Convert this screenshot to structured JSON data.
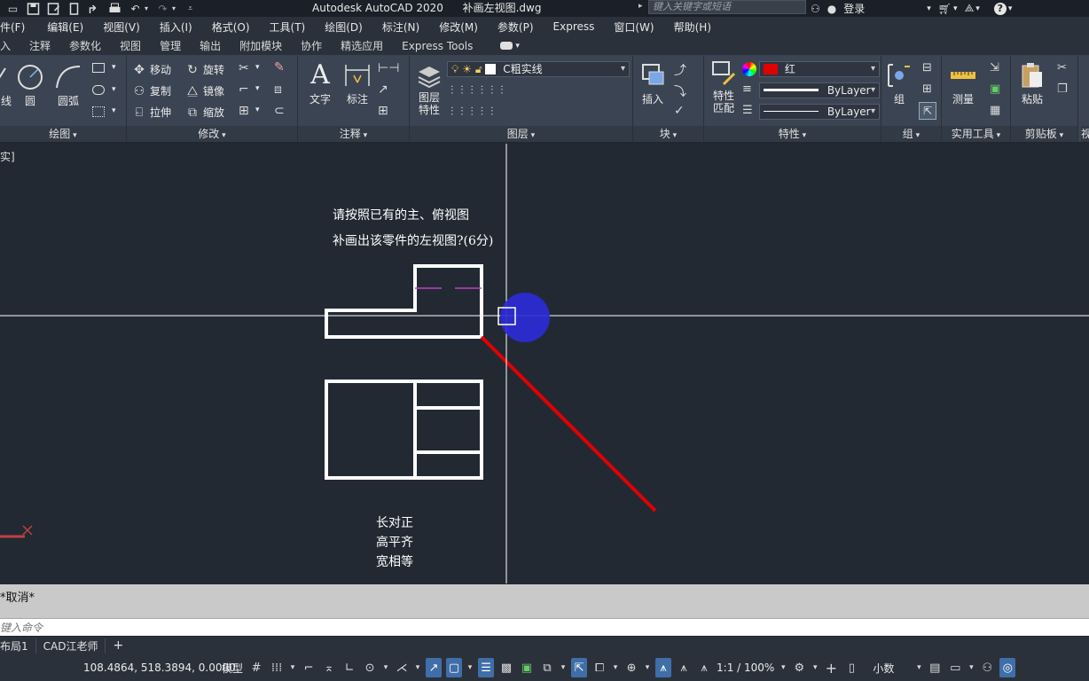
{
  "titlebar": {
    "app": "Autodesk AutoCAD 2020",
    "file": "补画左视图.dwg",
    "search_placeholder": "键入关键字或短语",
    "login": "登录"
  },
  "menu": [
    "件(F)",
    "编辑(E)",
    "视图(V)",
    "插入(I)",
    "格式(O)",
    "工具(T)",
    "绘图(D)",
    "标注(N)",
    "修改(M)",
    "参数(P)",
    "Express",
    "窗口(W)",
    "帮助(H)"
  ],
  "ribbon_tabs": [
    "入",
    "注释",
    "参数化",
    "视图",
    "管理",
    "输出",
    "附加模块",
    "协作",
    "精选应用",
    "Express Tools"
  ],
  "panels": {
    "draw": {
      "title": "绘图",
      "tools": [
        "线",
        "圆",
        "圆弧"
      ]
    },
    "modify": {
      "title": "修改",
      "tools": [
        "移动",
        "旋转",
        "复制",
        "镜像",
        "拉伸",
        "缩放"
      ]
    },
    "annotation": {
      "title": "注释",
      "tools": [
        "文字",
        "标注"
      ]
    },
    "layers": {
      "title": "图层",
      "big": "图层\n特性",
      "big_line1": "图层",
      "big_line2": "特性",
      "current_layer": "C粗实线"
    },
    "block": {
      "title": "块",
      "tool": "插入"
    },
    "properties": {
      "title": "特性",
      "match_line1": "特性",
      "match_line2": "匹配",
      "color": "红",
      "linetype": "ByLayer",
      "lineweight": "ByLayer"
    },
    "groups": {
      "title": "组",
      "tool": "组"
    },
    "utilities": {
      "title": "实用工具",
      "tool": "测量"
    },
    "clipboard": {
      "title": "剪贴板",
      "tool": "粘贴"
    },
    "view_cut": "视"
  },
  "drawing": {
    "viewport_label": "实]",
    "instruction_line1": "请按照已有的主、俯视图",
    "instruction_line2": "补画出该零件的左视图?(6分)",
    "rule1": "长对正",
    "rule2": "高平齐",
    "rule3": "宽相等"
  },
  "command": {
    "history": "*取消*",
    "placeholder": "键入命令"
  },
  "layout_tabs": [
    "布局1",
    "CAD江老师",
    "+"
  ],
  "statusbar": {
    "coords": "108.4864, 518.3894, 0.0000",
    "model": "模型",
    "scale": "1:1 / 100%",
    "units": "小数"
  },
  "colors": {
    "accent_red": "#e00000",
    "tracking_blue": "#2b2bd6",
    "background": "#222933"
  }
}
